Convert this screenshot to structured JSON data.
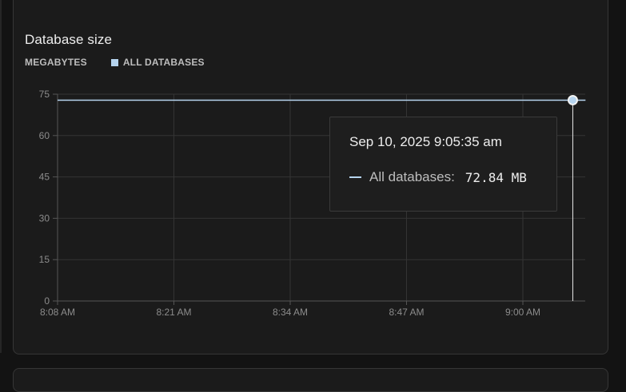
{
  "card": {
    "title": "Database size",
    "legend_unit": "MEGABYTES",
    "legend_series": "ALL DATABASES"
  },
  "colors": {
    "series": "#b6d4ee",
    "grid": "#343434",
    "axis": "#555555",
    "cursor": "#e8e8e8"
  },
  "tooltip": {
    "timestamp": "Sep 10, 2025 9:05:35 am",
    "series_label": "All databases:",
    "value_label": "72.84 MB"
  },
  "chart_data": {
    "type": "line",
    "x_ticks": [
      "8:08 AM",
      "8:21 AM",
      "8:34 AM",
      "8:47 AM",
      "9:00 AM"
    ],
    "y_ticks": [
      0,
      15,
      30,
      45,
      60,
      75
    ],
    "ylim": [
      0,
      75
    ],
    "xlim_minutes_after_8_08": [
      0,
      59
    ],
    "series": [
      {
        "name": "All databases",
        "unit": "MB",
        "points": [
          {
            "t": 0,
            "value": 72.84
          },
          {
            "t": 59,
            "value": 72.84
          }
        ]
      }
    ],
    "highlight": {
      "t": 57.58,
      "value": 72.84
    },
    "grid": true
  }
}
